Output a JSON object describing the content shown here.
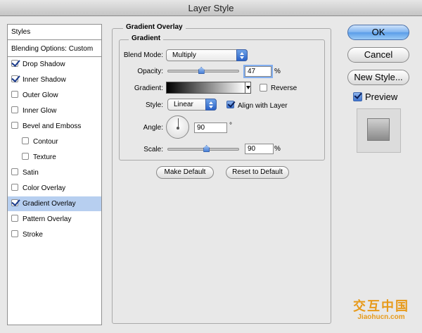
{
  "window": {
    "title": "Layer Style"
  },
  "sidebar": {
    "header": "Styles",
    "items": [
      {
        "label": "Blending Options: Custom",
        "checkbox": null,
        "selected": false,
        "sub": false
      },
      {
        "label": "Drop Shadow",
        "checkbox": true,
        "selected": false,
        "sub": false
      },
      {
        "label": "Inner Shadow",
        "checkbox": true,
        "selected": false,
        "sub": false
      },
      {
        "label": "Outer Glow",
        "checkbox": false,
        "selected": false,
        "sub": false
      },
      {
        "label": "Inner Glow",
        "checkbox": false,
        "selected": false,
        "sub": false
      },
      {
        "label": "Bevel and Emboss",
        "checkbox": false,
        "selected": false,
        "sub": false
      },
      {
        "label": "Contour",
        "checkbox": false,
        "selected": false,
        "sub": true
      },
      {
        "label": "Texture",
        "checkbox": false,
        "selected": false,
        "sub": true
      },
      {
        "label": "Satin",
        "checkbox": false,
        "selected": false,
        "sub": false
      },
      {
        "label": "Color Overlay",
        "checkbox": false,
        "selected": false,
        "sub": false
      },
      {
        "label": "Gradient Overlay",
        "checkbox": true,
        "selected": true,
        "sub": false
      },
      {
        "label": "Pattern Overlay",
        "checkbox": false,
        "selected": false,
        "sub": false
      },
      {
        "label": "Stroke",
        "checkbox": false,
        "selected": false,
        "sub": false
      }
    ]
  },
  "panel": {
    "title": "Gradient Overlay",
    "group_title": "Gradient",
    "blend_mode": {
      "label": "Blend Mode:",
      "value": "Multiply"
    },
    "opacity": {
      "label": "Opacity:",
      "value": "47",
      "unit": "%",
      "fraction": 0.47
    },
    "gradient": {
      "label": "Gradient:",
      "start_color": "#000000",
      "end_color": "#ffffff",
      "reverse_label": "Reverse",
      "reverse": false
    },
    "style": {
      "label": "Style:",
      "value": "Linear",
      "align_label": "Align with Layer",
      "align": true
    },
    "angle": {
      "label": "Angle:",
      "value": "90",
      "unit": "°"
    },
    "scale": {
      "label": "Scale:",
      "value": "90",
      "unit": "%",
      "fraction": 0.55
    },
    "make_default": "Make Default",
    "reset_default": "Reset to Default"
  },
  "actions": {
    "ok": "OK",
    "cancel": "Cancel",
    "new_style": "New Style...",
    "preview_label": "Preview",
    "preview": true
  },
  "watermark": {
    "big": "交互中国",
    "small": "Jiaohucn.com"
  },
  "colors": {
    "accent": "#5a9de8",
    "selection": "#b7cff0",
    "watermark": "#e79a1a"
  }
}
